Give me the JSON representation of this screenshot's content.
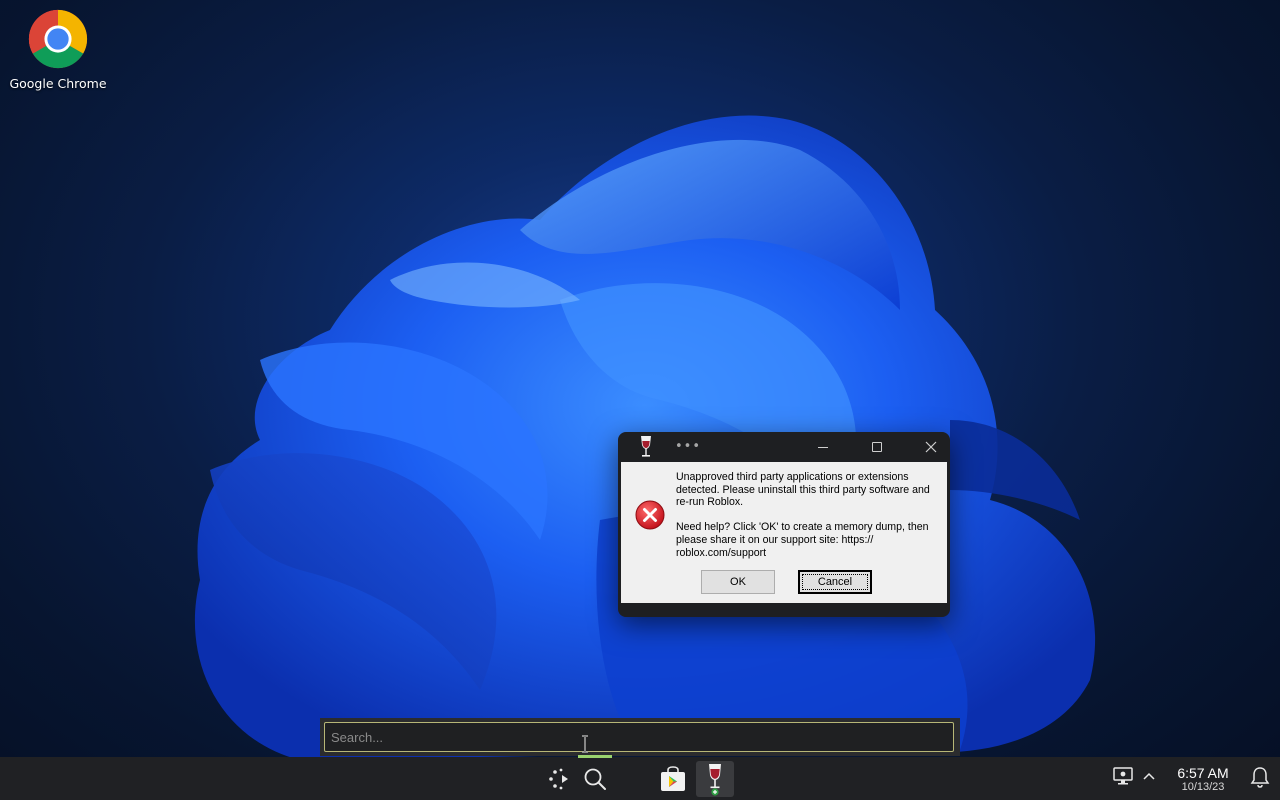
{
  "desktop": {
    "icons": [
      {
        "label": "Google Chrome",
        "icon": "chrome-icon"
      }
    ]
  },
  "dialog": {
    "title_menu": "•••",
    "app_icon": "wine-glass-icon",
    "message_icon": "error-icon",
    "message_line1": "Unapproved third party applications or extensions detected. Please uninstall this third party software and re-run Roblox.",
    "message_line2": "Need help? Click 'OK' to create a memory dump, then please share it on our support site: https:// roblox.com/support",
    "ok_label": "OK",
    "cancel_label": "Cancel",
    "focused_button": "Cancel",
    "error_color": "#e0212b"
  },
  "search": {
    "placeholder": "Search..."
  },
  "taskbar": {
    "items": [
      "launcher-icon",
      "search-icon",
      "store-icon",
      "wine-glass-icon"
    ],
    "active_indicator_color": "#9ad36e",
    "clock_time": "6:57 AM",
    "clock_date": "10/13/23"
  }
}
